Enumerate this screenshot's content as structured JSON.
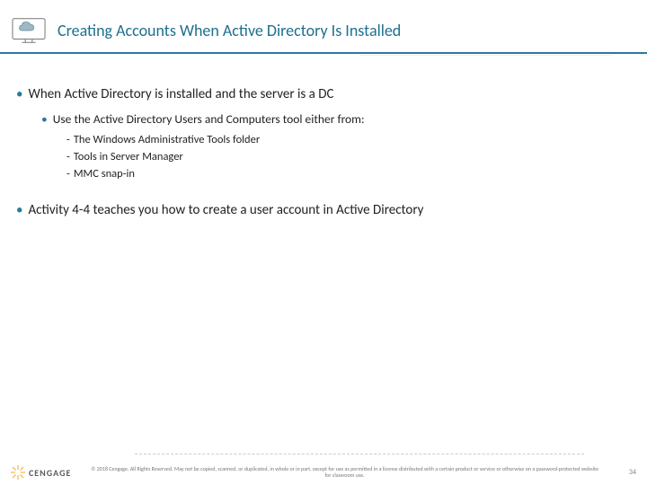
{
  "header": {
    "title": "Creating Accounts When Active Directory Is Installed"
  },
  "bullets": {
    "main1": "When Active Directory is installed and the server is a DC",
    "sub1": "Use the Active Directory Users and Computers tool either from:",
    "dash1": "The Windows Administrative Tools folder",
    "dash2": "Tools in Server Manager",
    "dash3": "MMC snap-in",
    "main2": "Activity 4-4 teaches you how to create a user account in Active Directory"
  },
  "footer": {
    "brand": "CENGAGE",
    "copyright": "© 2018 Cengage. All Rights Reserved. May not be copied, scanned, or duplicated, in whole or in part, except for use as permitted in a license distributed with a certain product or service or otherwise on a password-protected website for classroom use.",
    "page": "34"
  }
}
